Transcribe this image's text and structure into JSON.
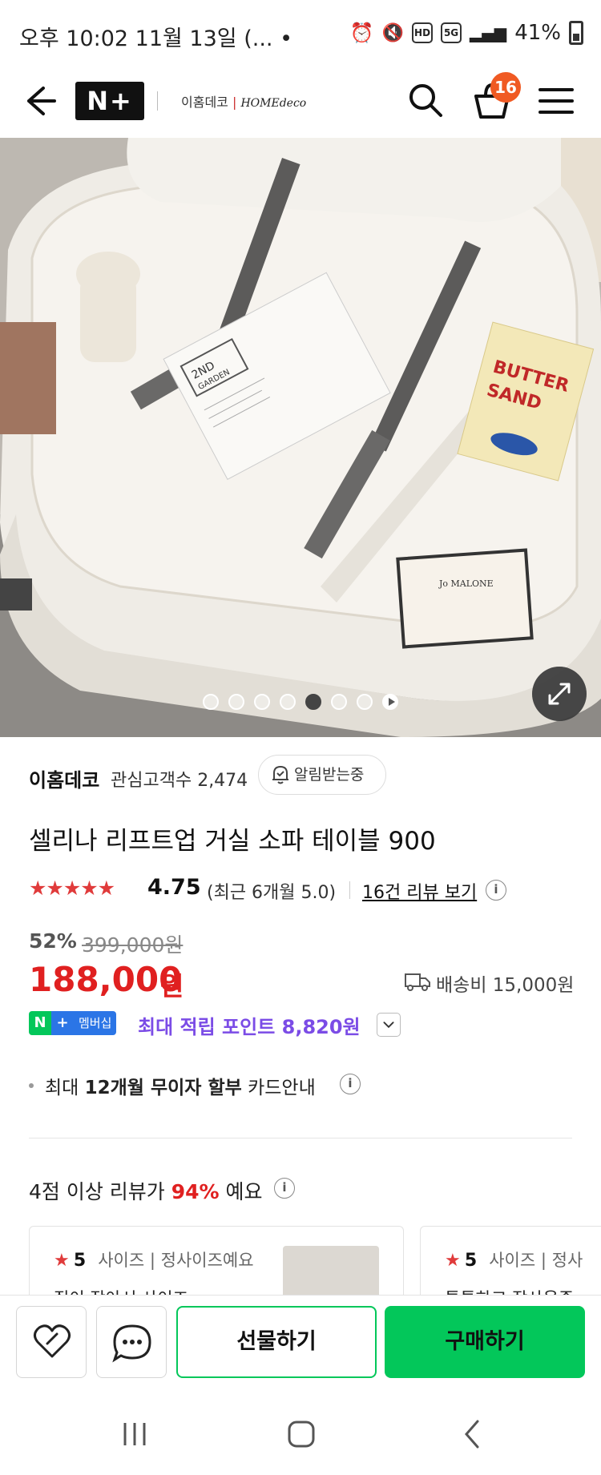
{
  "status_bar": {
    "time": "오후 10:02   11월 13일 (... •",
    "battery": "41%",
    "hd": "HD",
    "network": "5G"
  },
  "header": {
    "nplus": "N+",
    "brand": "이홈데코",
    "brand_sub": "HOMEdeco",
    "cart_count": "16"
  },
  "gallery": {
    "total": 7,
    "active_index": 4
  },
  "store": {
    "name": "이홈데코",
    "followers": "관심고객수 2,474",
    "alarm_label": "알림받는중"
  },
  "product": {
    "title": "셀리나 리프트업 거실 소파 테이블 900",
    "stars": "★★★★★",
    "rating": "4.75",
    "recent_rating": "(최근 6개월 5.0)",
    "reviews_link": "16건 리뷰 보기",
    "discount": "52%",
    "original_price": "399,000원",
    "price": "188,000",
    "currency": "원",
    "shipping": "배송비 15,000원"
  },
  "membership": {
    "n": "N",
    "plus": "+",
    "label": "멤버십",
    "points": "최대 적립 포인트 8,820원"
  },
  "installment": {
    "prefix": "최대 ",
    "bold": "12개월 무이자 할부",
    "suffix": " 카드안내"
  },
  "review_summary": {
    "prefix": "4점 이상 리뷰가 ",
    "percent": "94%",
    "suffix": " 예요"
  },
  "review_cards": [
    {
      "score": "5",
      "tag": "사이즈 | 정사이즈예요",
      "snippet": "집이 작아서 사이즈"
    },
    {
      "score": "5",
      "tag": "사이즈 | 정사",
      "snippet": "튼튼하고 작사용중"
    }
  ],
  "bottom": {
    "gift": "선물하기",
    "buy": "구매하기"
  },
  "colors": {
    "naver_green": "#03c75a",
    "price_red": "#e02020",
    "point_purple": "#7b4ce6",
    "badge_orange": "#f05a23"
  }
}
